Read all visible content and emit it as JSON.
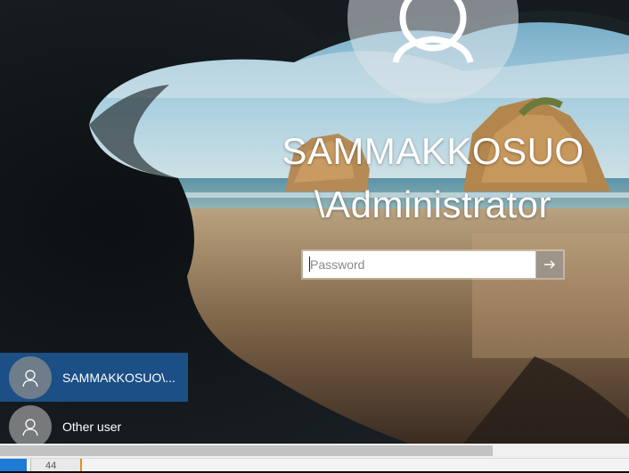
{
  "lock_screen": {
    "account": {
      "name_line1": "SAMMAKKOSUO",
      "name_line2": "\\Administrator",
      "avatar_icon": "user-silhouette-icon"
    },
    "password": {
      "placeholder": "Password",
      "value": "",
      "submit_icon": "arrow-right-icon"
    },
    "user_list": [
      {
        "label": "SAMMAKKOSUO\\...",
        "selected": true,
        "icon": "user-silhouette-icon"
      },
      {
        "label": "Other user",
        "selected": false,
        "icon": "user-silhouette-icon"
      }
    ]
  },
  "window": {
    "scrollbar": {
      "thumb_fraction": 0.78
    },
    "taskbar_text": "44"
  },
  "colors": {
    "selected_user_bg": "#1b4f86",
    "text": "#ffffff",
    "taskbar_accent": "#1f7bd6",
    "indicator": "#ef8a1b"
  }
}
